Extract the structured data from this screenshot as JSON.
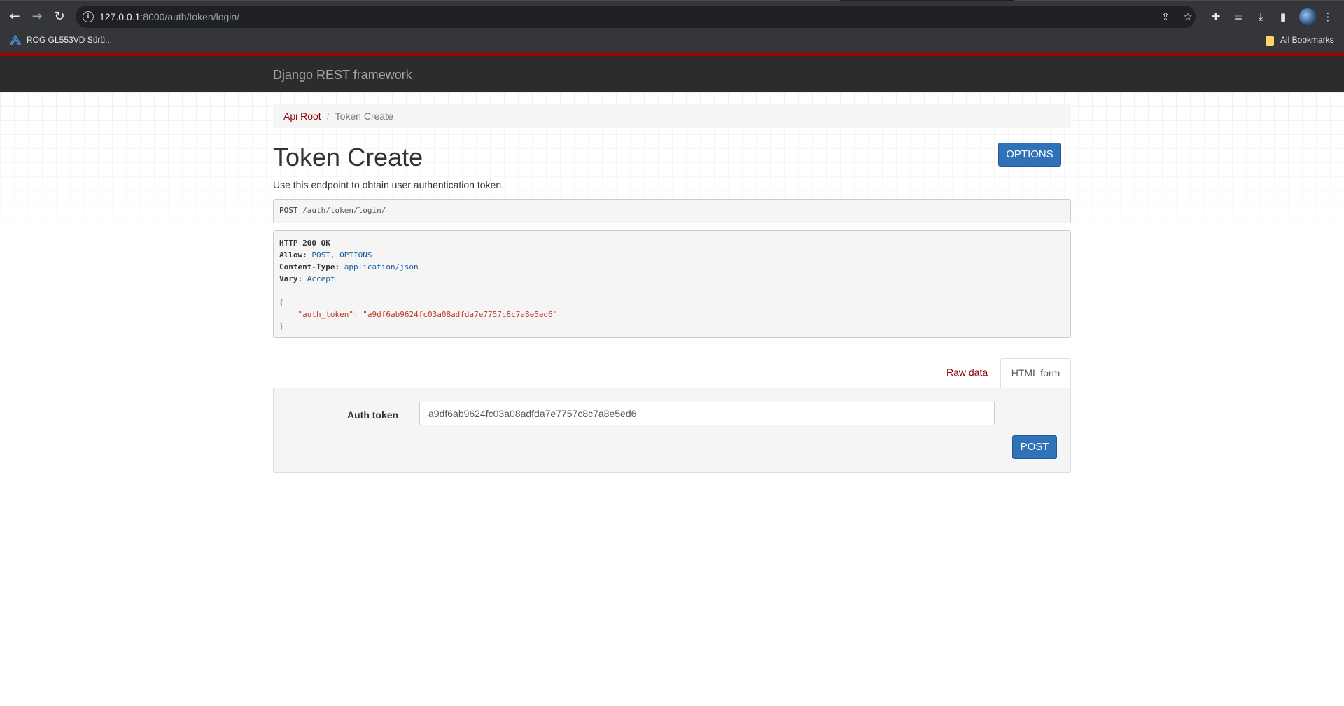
{
  "browser": {
    "url_host": "127.0.0.1",
    "url_rest": ":8000/auth/token/login/",
    "bookmark": "ROG GL553VD Sürü...",
    "all_bookmarks": "All Bookmarks",
    "icons": [
      "back-arrow-icon",
      "forward-arrow-icon",
      "reload-icon",
      "info-icon",
      "share-icon",
      "star-icon",
      "extensions-icon",
      "reading-list-icon",
      "download-icon",
      "side-panel-icon",
      "profile-avatar",
      "kebab-menu-icon",
      "asus-logo-icon",
      "bookmark-folder-icon"
    ]
  },
  "navbar": {
    "brand": "Django REST framework"
  },
  "breadcrumb": {
    "root": "Api Root",
    "separator": "/",
    "current": "Token Create"
  },
  "page": {
    "title": "Token Create",
    "options_label": "OPTIONS",
    "description": "Use this endpoint to obtain user authentication token."
  },
  "request": {
    "method": "POST",
    "path": "/auth/token/login/"
  },
  "response": {
    "status": "HTTP 200 OK",
    "headers": [
      {
        "key": "Allow:",
        "value": "POST, OPTIONS"
      },
      {
        "key": "Content-Type:",
        "value": "application/json"
      },
      {
        "key": "Vary:",
        "value": "Accept"
      }
    ],
    "open_brace": "{",
    "close_brace": "}",
    "body_key": "\"auth_token\"",
    "body_colon": ": ",
    "body_value": "\"a9df6ab9624fc03a08adfda7e7757c8c7a8e5ed6\""
  },
  "tabs": {
    "raw": "Raw data",
    "html": "HTML form"
  },
  "form": {
    "label": "Auth token",
    "value": "a9df6ab9624fc03a08adfda7e7757c8c7a8e5ed6",
    "submit": "POST"
  },
  "colors": {
    "navbar": "#2c2c2c",
    "navbar_accent": "#a30000",
    "button": "#2f72b8",
    "link": "#8b0000"
  }
}
